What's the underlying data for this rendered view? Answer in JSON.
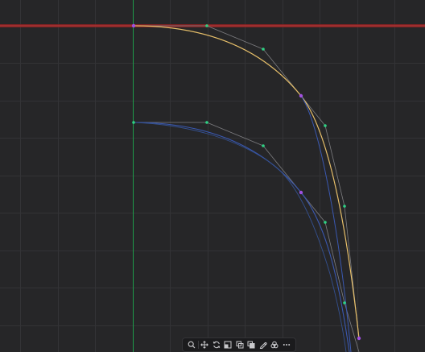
{
  "colors": {
    "background": "#262628",
    "grid": "#333336",
    "baseline_horizontal": "#8b2323",
    "baseline_vertical": "#1f9c4a",
    "curve_primary": "#e8c06a",
    "curve_secondary": "#3a58b0",
    "handle_line": "#7d7d80",
    "point_anchor": "#a050e0",
    "point_handle": "#2ed183",
    "toolbar_icon": "#c9c9cc"
  },
  "toolbar": {
    "items": [
      {
        "icon": "search-icon"
      },
      {
        "icon": "move-icon"
      },
      {
        "icon": "refresh-icon"
      },
      {
        "icon": "fit-icon"
      },
      {
        "icon": "copy-icon"
      },
      {
        "icon": "paste-icon"
      },
      {
        "icon": "edit-icon"
      },
      {
        "icon": "layers-icon"
      },
      {
        "icon": "more-icon"
      }
    ]
  }
}
